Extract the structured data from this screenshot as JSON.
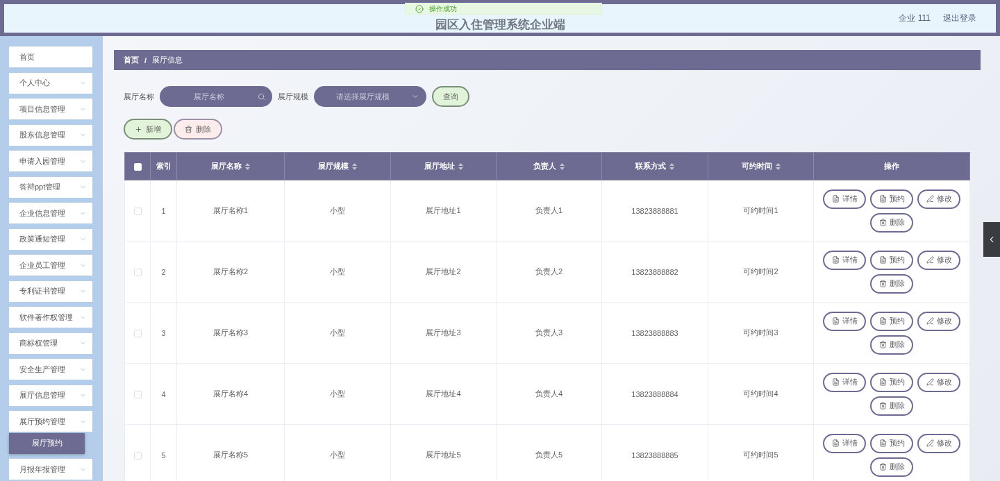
{
  "header": {
    "title": "园区入住管理系统企业端",
    "user": "企业 111",
    "logout": "退出登录"
  },
  "toast": {
    "message": "操作成功"
  },
  "sidebar": {
    "items": [
      {
        "kind": "link",
        "label": "首页"
      },
      {
        "kind": "menu",
        "label": "个人中心"
      },
      {
        "kind": "menu",
        "label": "项目信息管理"
      },
      {
        "kind": "menu",
        "label": "股东信息管理"
      },
      {
        "kind": "menu",
        "label": "申请入园管理"
      },
      {
        "kind": "menu",
        "label": "答辩ppt管理"
      },
      {
        "kind": "menu",
        "label": "企业信息管理"
      },
      {
        "kind": "menu",
        "label": "政策通知管理"
      },
      {
        "kind": "menu",
        "label": "企业员工管理"
      },
      {
        "kind": "menu",
        "label": "专利证书管理"
      },
      {
        "kind": "menu",
        "label": "软件著作权管理"
      },
      {
        "kind": "menu",
        "label": "商标权管理"
      },
      {
        "kind": "menu",
        "label": "安全生产管理"
      },
      {
        "kind": "menu",
        "label": "展厅信息管理"
      },
      {
        "kind": "menu",
        "label": "展厅预约管理",
        "children": [
          {
            "label": "展厅预约",
            "selected": true
          }
        ]
      },
      {
        "kind": "menu",
        "label": "月报年报管理"
      }
    ]
  },
  "breadcrumb": [
    "首页",
    "/",
    "展厅信息"
  ],
  "search": {
    "name_label": "展厅名称",
    "name_placeholder": "展厅名称",
    "scale_label": "展厅规模",
    "scale_placeholder": "请选择展厅规模",
    "query": "查询"
  },
  "toolbar": {
    "add": "新增",
    "delete": "删除"
  },
  "table": {
    "select_all": {
      "checked": false
    },
    "columns": [
      {
        "label": "索引",
        "sortable": false
      },
      {
        "label": "展厅名称",
        "sortable": true
      },
      {
        "label": "展厅规模",
        "sortable": true
      },
      {
        "label": "展厅地址",
        "sortable": true
      },
      {
        "label": "负责人",
        "sortable": true
      },
      {
        "label": "联系方式",
        "sortable": true
      },
      {
        "label": "可约时间",
        "sortable": true
      },
      {
        "label": "操作",
        "sortable": false
      }
    ],
    "rows": [
      {
        "checked": false,
        "cells": [
          "1",
          "展厅名称1",
          "小型",
          "展厅地址1",
          "负责人1",
          "13823888881",
          "可约时间1"
        ],
        "actions": [
          {
            "kind": "detail",
            "label": "详情"
          },
          {
            "kind": "book",
            "label": "预约"
          },
          {
            "kind": "edit",
            "label": "修改"
          },
          {
            "kind": "delete",
            "label": "删除"
          }
        ]
      },
      {
        "checked": false,
        "cells": [
          "2",
          "展厅名称2",
          "小型",
          "展厅地址2",
          "负责人2",
          "13823888882",
          "可约时间2"
        ],
        "actions": [
          {
            "kind": "detail",
            "label": "详情"
          },
          {
            "kind": "book",
            "label": "预约"
          },
          {
            "kind": "edit",
            "label": "修改"
          },
          {
            "kind": "delete",
            "label": "删除"
          }
        ]
      },
      {
        "checked": false,
        "cells": [
          "3",
          "展厅名称3",
          "小型",
          "展厅地址3",
          "负责人3",
          "13823888883",
          "可约时间3"
        ],
        "actions": [
          {
            "kind": "detail",
            "label": "详情"
          },
          {
            "kind": "book",
            "label": "预约"
          },
          {
            "kind": "edit",
            "label": "修改"
          },
          {
            "kind": "delete",
            "label": "删除"
          }
        ]
      },
      {
        "checked": false,
        "cells": [
          "4",
          "展厅名称4",
          "小型",
          "展厅地址4",
          "负责人4",
          "13823888884",
          "可约时间4"
        ],
        "actions": [
          {
            "kind": "detail",
            "label": "详情"
          },
          {
            "kind": "book",
            "label": "预约"
          },
          {
            "kind": "edit",
            "label": "修改"
          },
          {
            "kind": "delete",
            "label": "删除"
          }
        ]
      },
      {
        "checked": false,
        "cells": [
          "5",
          "展厅名称5",
          "小型",
          "展厅地址5",
          "负责人5",
          "13823888885",
          "可约时间5"
        ],
        "actions": [
          {
            "kind": "detail",
            "label": "详情"
          },
          {
            "kind": "book",
            "label": "预约"
          },
          {
            "kind": "edit",
            "label": "修改"
          },
          {
            "kind": "delete",
            "label": "删除"
          }
        ]
      }
    ]
  }
}
